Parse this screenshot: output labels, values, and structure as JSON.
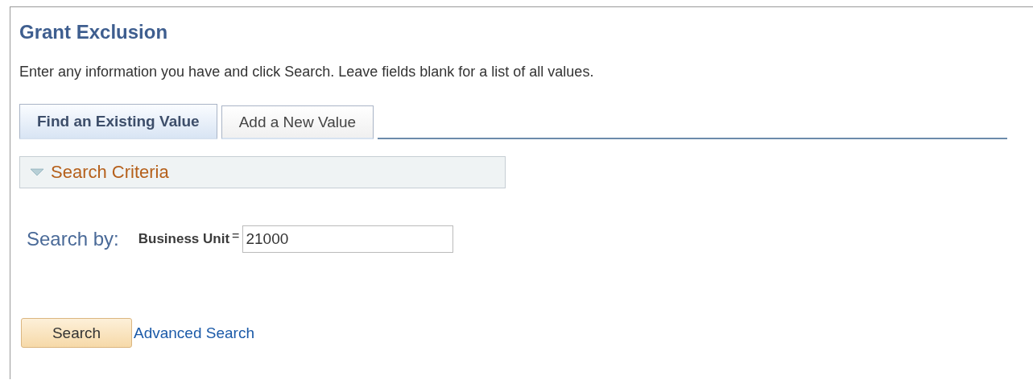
{
  "title": "Grant Exclusion",
  "instructions": "Enter any information you have and click Search. Leave fields blank for a list of all values.",
  "tabs": [
    {
      "label": "Find an Existing Value",
      "selected": true
    },
    {
      "label": "Add a New Value",
      "selected": false
    }
  ],
  "section": {
    "label": "Search Criteria",
    "expanded": true
  },
  "search_by": {
    "label": "Search by:",
    "field_label": "Business Unit",
    "operator": "=",
    "value": "21000"
  },
  "buttons": {
    "search": "Search",
    "advanced_link": "Advanced Search"
  }
}
